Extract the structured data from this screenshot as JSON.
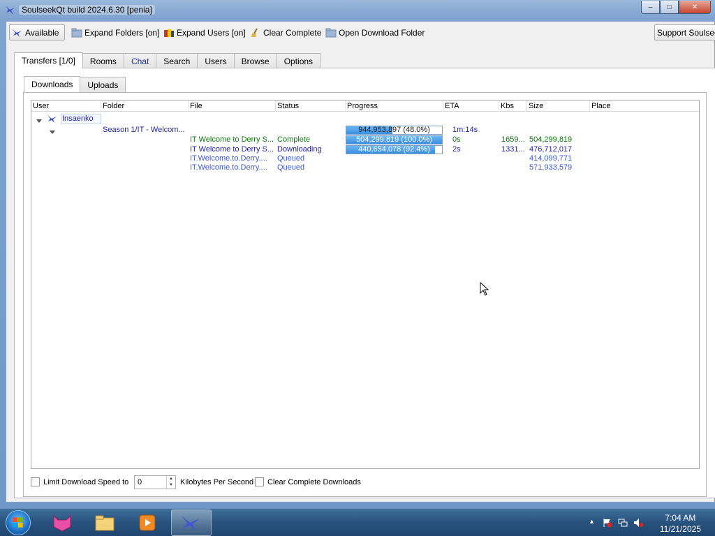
{
  "window": {
    "title": "SoulseekQt build 2024.6.30 [penia]",
    "buttons": {
      "minimize": "–",
      "maximize": "□",
      "close": "✕"
    }
  },
  "toolbar": {
    "status_label": "Available",
    "expand_folders": "Expand Folders [on]",
    "expand_users": "Expand Users [on]",
    "clear_complete": "Clear Complete",
    "open_download_folder": "Open Download Folder",
    "support": "Support Soulseek"
  },
  "main_tabs": [
    "Transfers [1/0]",
    "Rooms",
    "Chat",
    "Search",
    "Users",
    "Browse",
    "Options"
  ],
  "sub_tabs": [
    "Downloads",
    "Uploads"
  ],
  "columns": [
    "User",
    "Folder",
    "File",
    "Status",
    "Progress",
    "ETA",
    "Kbs",
    "Size",
    "Place"
  ],
  "transfers": {
    "user": "Insaenko",
    "folder": {
      "name": "Season 1/IT - Welcom...",
      "progress_text": "944,953,897 (48.0%)",
      "progress": 0.48,
      "eta": "1m:14s"
    },
    "files": [
      {
        "file": "IT Welcome to Derry S...",
        "status": "Complete",
        "progress_text": "504,299,819 (100.0%)",
        "progress": 1.0,
        "eta": "0s",
        "kbs": "1659...",
        "size": "504,299,819",
        "color": "green"
      },
      {
        "file": "IT Welcome to Derry S...",
        "status": "Downloading",
        "progress_text": "440,654,078 (92.4%)",
        "progress": 0.924,
        "eta": "2s",
        "kbs": "1331...",
        "size": "476,712,017",
        "color": "navy"
      },
      {
        "file": "IT.Welcome.to.Derry....",
        "status": "Queued",
        "progress_text": "",
        "progress": null,
        "eta": "",
        "kbs": "",
        "size": "414,099,771",
        "color": "blue"
      },
      {
        "file": "IT.Welcome.to.Derry....",
        "status": "Queued",
        "progress_text": "",
        "progress": null,
        "eta": "",
        "kbs": "",
        "size": "571,933,579",
        "color": "blue"
      }
    ]
  },
  "bottom": {
    "limit_label": "Limit Download Speed to",
    "speed_value": "0",
    "unit_label": "Kilobytes Per Second",
    "clear_complete_label": "Clear Complete Downloads"
  },
  "taskbar": {
    "time": "7:04 AM",
    "date": "11/21/2025"
  }
}
